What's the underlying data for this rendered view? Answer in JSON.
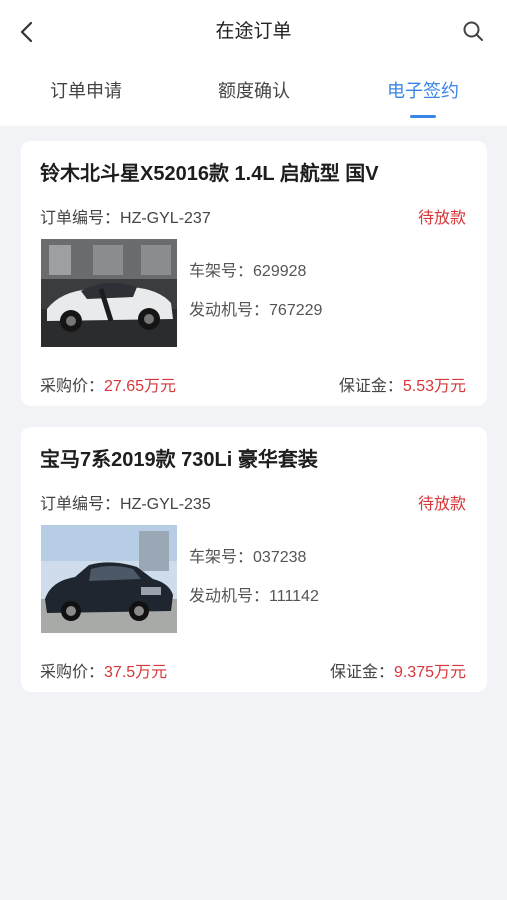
{
  "header": {
    "title": "在途订单"
  },
  "tabs": [
    {
      "label": "订单申请"
    },
    {
      "label": "额度确认"
    },
    {
      "label": "电子签约"
    }
  ],
  "orders": [
    {
      "title": "铃木北斗星X52016款 1.4L 启航型 国V",
      "order_label": "订单编号：",
      "order_no": "HZ-GYL-237",
      "status": "待放款",
      "frame_label": "车架号：",
      "frame_no": "629928",
      "engine_label": "发动机号：",
      "engine_no": "767229",
      "price_label": "采购价：",
      "price": "27.65万元",
      "deposit_label": "保证金：",
      "deposit": "5.53万元"
    },
    {
      "title": "宝马7系2019款 730Li 豪华套装",
      "order_label": "订单编号：",
      "order_no": "HZ-GYL-235",
      "status": "待放款",
      "frame_label": "车架号：",
      "frame_no": "037238",
      "engine_label": "发动机号：",
      "engine_no": "111142",
      "price_label": "采购价：",
      "price": "37.5万元",
      "deposit_label": "保证金：",
      "deposit": "9.375万元"
    }
  ],
  "icons": {
    "back": "chevron-left-icon",
    "search": "search-icon"
  },
  "colors": {
    "accent": "#3a86e8",
    "status_red": "#d6373a",
    "background": "#f2f3f7"
  }
}
